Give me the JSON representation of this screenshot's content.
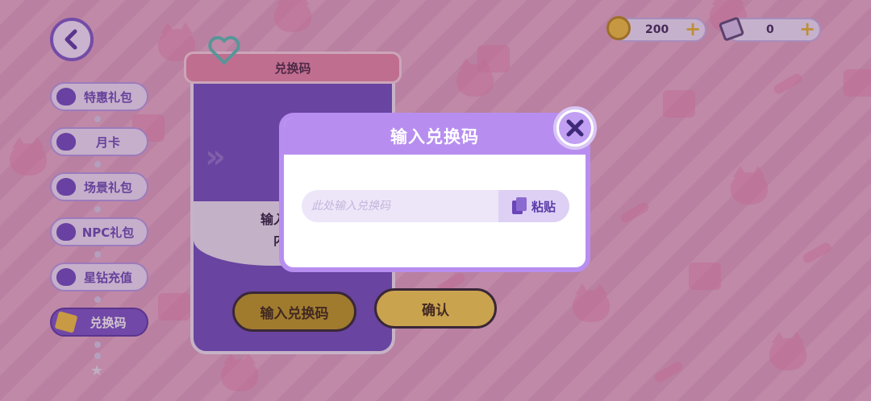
{
  "nav": {
    "back_icon": "chevron-left-icon",
    "items": [
      {
        "label": "特惠礼包",
        "icon": "cat-icon"
      },
      {
        "label": "月卡",
        "icon": "cat-icon"
      },
      {
        "label": "场景礼包",
        "icon": "cat-icon"
      },
      {
        "label": "NPC礼包",
        "icon": "cat-icon"
      },
      {
        "label": "星钻充值",
        "icon": "cat-icon"
      },
      {
        "label": "兑换码",
        "icon": "star-icon",
        "active": true
      }
    ]
  },
  "currency": {
    "coins": "200",
    "gems": "0",
    "add_symbol": "+"
  },
  "panel": {
    "title": "兑换码",
    "text_line1": "输入兑换码",
    "text_line2": "内获得",
    "enter_code_button": "输入兑换码",
    "confirm_button": "确认"
  },
  "modal": {
    "title": "输入兑换码",
    "input_placeholder": "此处输入兑换码",
    "input_value": "",
    "paste_label": "粘贴"
  },
  "colors": {
    "accent_purple": "#b78ef0",
    "button_yellow": "#f6d34e",
    "background_pink": "#e3a9c6"
  }
}
